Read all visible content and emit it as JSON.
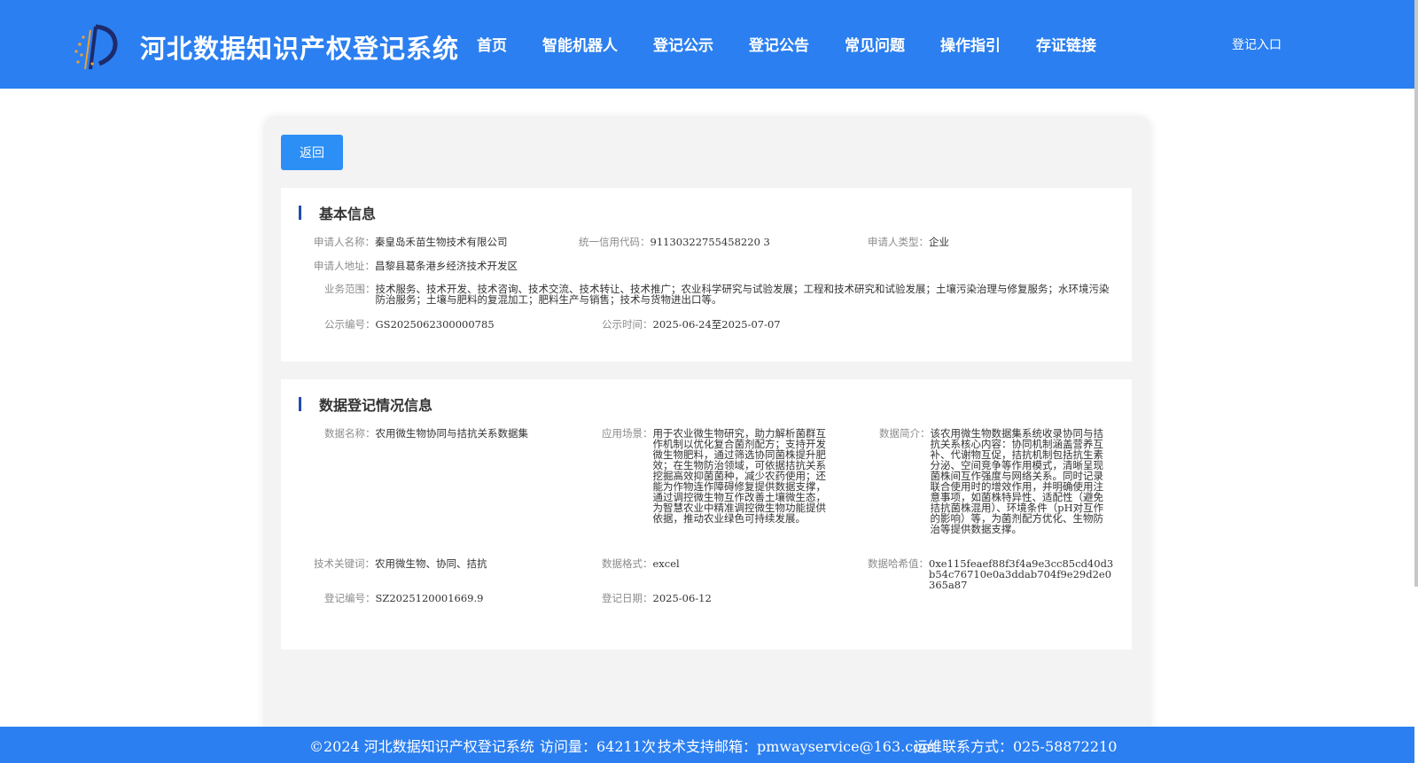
{
  "header": {
    "title": "河北数据知识产权登记系统",
    "nav": [
      "首页",
      "智能机器人",
      "登记公示",
      "登记公告",
      "常见问题",
      "操作指引",
      "存证链接"
    ],
    "login": "登记入口",
    "colors": {
      "primary": "#2b7ff0",
      "logo_star": "#f0a030",
      "logo_dark": "#1d2a6b"
    }
  },
  "back_button": "返回",
  "basic_info": {
    "title": "基本信息",
    "applicant_name": {
      "label": "申请人名称：",
      "value": "秦皇岛禾苗生物技术有限公司"
    },
    "credit_code": {
      "label": "统一信用代码：",
      "value": "91130322755458220 3"
    },
    "applicant_type": {
      "label": "申请人类型：",
      "value": "企业"
    },
    "address": {
      "label": "申请人地址：",
      "value": "昌黎县葛条港乡经济技术开发区"
    },
    "business_scope": {
      "label": "业务范围：",
      "value": "技术服务、技术开发、技术咨询、技术交流、技术转让、技术推广；农业科学研究与试验发展；工程和技术研究和试验发展；土壤污染治理与修复服务；水环境污染防治服务；土壤与肥料的复混加工；肥料生产与销售；技术与货物进出口等。"
    },
    "notice_no": {
      "label": "公示编号：",
      "value": "GS2025062300000785"
    },
    "notice_time": {
      "label": "公示时间：",
      "value": "2025-06-24至2025-07-07"
    }
  },
  "data_info": {
    "title": "数据登记情况信息",
    "data_name": {
      "label": "数据名称：",
      "value": "农用微生物协同与拮抗关系数据集"
    },
    "scenario": {
      "label": "应用场景：",
      "value": "用于农业微生物研究，助力解析菌群互作机制以优化复合菌剂配方；支持开发微生物肥料，通过筛选协同菌株提升肥效；在生物防治领域，可依据拮抗关系挖掘高效抑菌菌种，减少农药使用；还能为作物连作障碍修复提供数据支撑，通过调控微生物互作改善土壤微生态，为智慧农业中精准调控微生物功能提供依据，推动农业绿色可持续发展。"
    },
    "summary": {
      "label": "数据简介：",
      "value": "该农用微生物数据集系统收录协同与拮抗关系核心内容：协同机制涵盖营养互补、代谢物互促，拮抗机制包括抗生素分泌、空间竞争等作用模式，清晰呈现菌株间互作强度与网络关系。同时记录联合使用时的增效作用，并明确使用注意事项，如菌株特异性、适配性（避免拮抗菌株混用）、环境条件（pH对互作的影响）等，为菌剂配方优化、生物防治等提供数据支撑。"
    },
    "keywords": {
      "label": "技术关键词：",
      "value": "农用微生物、协同、拮抗"
    },
    "format": {
      "label": "数据格式：",
      "value": "excel"
    },
    "hash": {
      "label": "数据哈希值：",
      "value": "0xe115feaef88f3f4a9e3cc85cd40d3b54c76710e0a3ddab704f9e29d2e0365a87"
    },
    "reg_no": {
      "label": "登记编号：",
      "value": "SZ2025120001669.9"
    },
    "reg_date": {
      "label": "登记日期：",
      "value": "2025-06-12"
    }
  },
  "footer": {
    "copyright": "©2024 河北数据知识产权登记系统",
    "visits": "访问量：64211次",
    "email": "技术支持邮箱：pmwayservice@163.com",
    "phone": "运维联系方式：025-58872210"
  }
}
